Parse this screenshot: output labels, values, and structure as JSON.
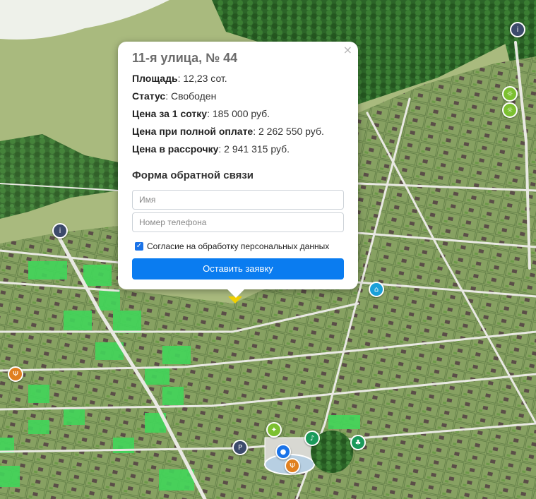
{
  "popup": {
    "title": "11-я улица, № 44",
    "close_glyph": "×",
    "area_label": "Площадь",
    "area_value": ": 12,23 сот.",
    "status_label": "Статус",
    "status_value": ": Свободен",
    "price_label": "Цена за 1 сотку",
    "price_value": ": 185 000 руб.",
    "full_label": "Цена при полной оплате",
    "full_value": ": 2 262 550 руб.",
    "install_label": "Цена в рассрочку",
    "install_value": ": 2 941 315 руб."
  },
  "form": {
    "title": "Форма обратной связи",
    "name_placeholder": "Имя",
    "phone_placeholder": "Номер телефона",
    "consent_label": "Согласие на обработку персональных данных",
    "consent_checked": true,
    "submit_label": "Оставить заявку"
  },
  "map": {
    "colors": {
      "field": "#a6b97c",
      "forest": "#2f6b2c",
      "plots": "#7f9c5c",
      "free_plot": "#3ddc55",
      "road": "#e6e6e0",
      "accent": "#0a7cf0"
    },
    "markers": [
      {
        "icon": "parking-icon",
        "glyph": "P",
        "color": "#3c4a6b"
      },
      {
        "icon": "info-icon",
        "glyph": "i",
        "color": "#3c4a6b"
      },
      {
        "icon": "info-icon",
        "glyph": "i",
        "color": "#3c4a6b"
      },
      {
        "icon": "bus-icon",
        "glyph": "⌂",
        "color": "#1aa0d8"
      },
      {
        "icon": "food-icon",
        "glyph": "Ψ",
        "color": "#e08020"
      },
      {
        "icon": "food-icon",
        "glyph": "Ψ",
        "color": "#e08020"
      },
      {
        "icon": "playground-icon",
        "glyph": "☼",
        "color": "#7cc030"
      },
      {
        "icon": "playground-icon",
        "glyph": "☼",
        "color": "#7cc030"
      },
      {
        "icon": "music-icon",
        "glyph": "♪",
        "color": "#1a9a5a"
      },
      {
        "icon": "tree-icon",
        "glyph": "♣",
        "color": "#1a9a5a"
      },
      {
        "icon": "sport-icon",
        "glyph": "✦",
        "color": "#7cc030"
      },
      {
        "icon": "pin-icon",
        "glyph": "●",
        "color": "#1a73e8"
      }
    ]
  }
}
